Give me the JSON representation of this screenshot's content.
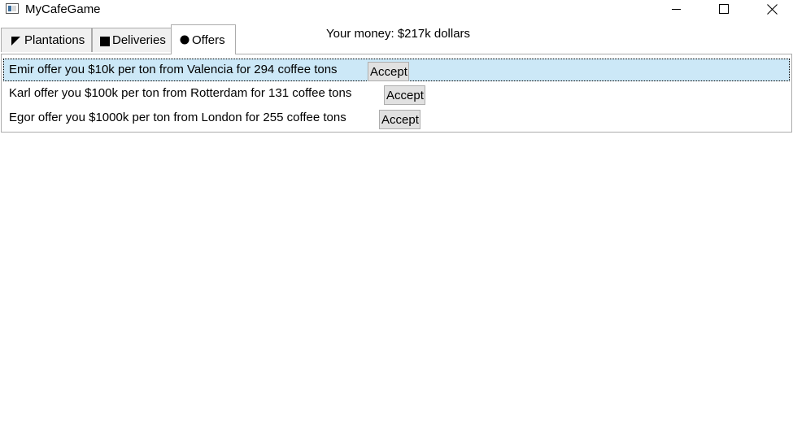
{
  "window": {
    "title": "MyCafeGame",
    "icon": "app-window-icon",
    "controls": [
      "minimize-icon",
      "maximize-icon",
      "close-icon"
    ]
  },
  "tabs": [
    {
      "label": "Plantations",
      "icon": "triangle-icon",
      "selected": false
    },
    {
      "label": "Deliveries",
      "icon": "square-icon",
      "selected": false
    },
    {
      "label": "Offers",
      "icon": "circle-icon",
      "selected": true
    }
  ],
  "status": {
    "money_text": "Your money: $217k dollars"
  },
  "offers": [
    {
      "text": "Emir offer you $10k per ton from Valencia for 294 coffee tons",
      "button_label": "Accept",
      "selected": true
    },
    {
      "text": "Karl offer you $100k per ton from Rotterdam for 131 coffee tons",
      "button_label": "Accept",
      "selected": false
    },
    {
      "text": "Egor offer you $1000k per ton from London for 255 coffee tons",
      "button_label": "Accept",
      "selected": false
    }
  ],
  "colors": {
    "selection_background": "#cce8f7",
    "button_background": "#e1e1e1",
    "tab_background": "#f0f0f0"
  }
}
